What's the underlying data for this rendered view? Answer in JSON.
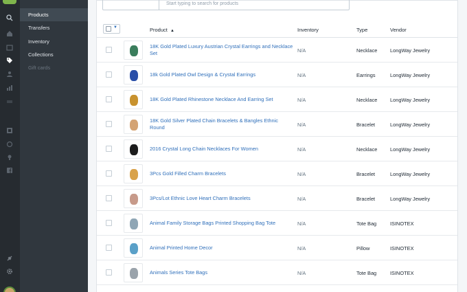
{
  "nav": {
    "items": [
      {
        "label": "Products",
        "state": "active"
      },
      {
        "label": "Transfers",
        "state": "normal"
      },
      {
        "label": "Inventory",
        "state": "normal"
      },
      {
        "label": "Collections",
        "state": "normal"
      },
      {
        "label": "Gift cards",
        "state": "disabled"
      }
    ]
  },
  "rail_icons": [
    "search-icon",
    "home-icon",
    "orders-icon",
    "products-icon",
    "customers-icon",
    "reports-icon",
    "discounts-icon",
    "apps-icon",
    "online-store-icon",
    "pos-icon",
    "buy-button-icon",
    "facebook-icon",
    "plug-icon",
    "settings-icon"
  ],
  "search": {
    "placeholder": "Start typing to search for products"
  },
  "table": {
    "headers": {
      "product": "Product",
      "sort_indicator": "▲",
      "inventory": "Inventory",
      "type": "Type",
      "vendor": "Vendor"
    },
    "rows": [
      {
        "name": "18K Gold Plated Luxury Austrian Crystal Earrings and Necklace Set",
        "inventory": "N/A",
        "type": "Necklace",
        "vendor": "LongWay Jewelry",
        "thumb_color": "#3a7d5c"
      },
      {
        "name": "18k Gold Plated Owl Design & Crystal Earrings",
        "inventory": "N/A",
        "type": "Earrings",
        "vendor": "LongWay Jewelry",
        "thumb_color": "#2a4fa8"
      },
      {
        "name": "18K Gold Plated Rhinestone Necklace And Earring Set",
        "inventory": "N/A",
        "type": "Necklace",
        "vendor": "LongWay Jewelry",
        "thumb_color": "#c8922e"
      },
      {
        "name": "18K Gold Silver Plated Chain Bracelets & Bangles Ethnic Round",
        "inventory": "N/A",
        "type": "Bracelet",
        "vendor": "LongWay Jewelry",
        "thumb_color": "#d4a373"
      },
      {
        "name": "2016 Crystal Long Chain Necklaces For Women",
        "inventory": "N/A",
        "type": "Necklace",
        "vendor": "LongWay Jewelry",
        "thumb_color": "#1c1c1c"
      },
      {
        "name": "3Pcs Gold Filled Charm Bracelets",
        "inventory": "N/A",
        "type": "Bracelet",
        "vendor": "LongWay Jewelry",
        "thumb_color": "#d9a24a"
      },
      {
        "name": "3Pcs/Lot Ethnic Love Heart Charm Bracelets",
        "inventory": "N/A",
        "type": "Bracelet",
        "vendor": "LongWay Jewelry",
        "thumb_color": "#c79a8a"
      },
      {
        "name": "Animal Family Storage Bags Printed Shopping Bag Tote",
        "inventory": "N/A",
        "type": "Tote Bag",
        "vendor": "ISINOTEX",
        "thumb_color": "#8fa6b5"
      },
      {
        "name": "Animal Printed Home Decor",
        "inventory": "N/A",
        "type": "Pillow",
        "vendor": "ISINOTEX",
        "thumb_color": "#5aa0c8"
      },
      {
        "name": "Animals Series Tote Bags",
        "inventory": "N/A",
        "type": "Tote Bag",
        "vendor": "ISINOTEX",
        "thumb_color": "#9aa3ab"
      }
    ]
  }
}
